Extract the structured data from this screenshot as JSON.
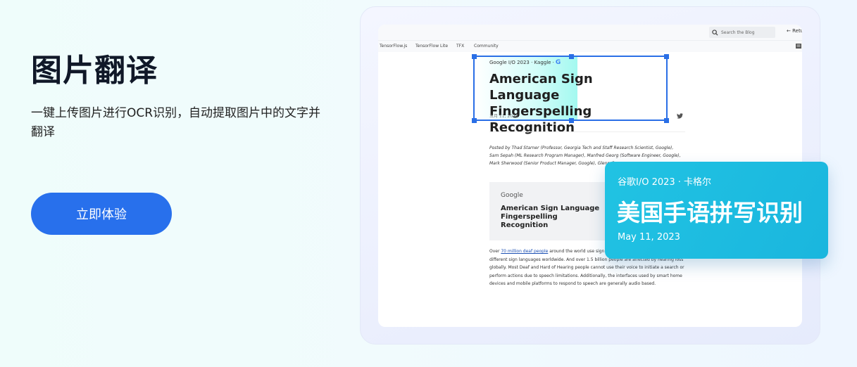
{
  "hero": {
    "title": "图片翻译",
    "description": "一键上传图片进行OCR识别，自动提取图片中的文字并翻译",
    "cta_label": "立即体验"
  },
  "preview": {
    "search_placeholder": "Search the Blog",
    "return_label": "Retu",
    "nav_items": [
      "TensorFlow.js",
      "TensorFlow Lite",
      "TFX",
      "Community"
    ],
    "article": {
      "meta": "Google I/O 2023 · Kaggle ·",
      "title_line1": "American Sign Language",
      "title_line2": "Fingerspelling Recognition",
      "date": "五月 11, 2023",
      "posted_by": "Posted by Thad Starner (Professor, Georgia Tech and Staff Research Scientist, Google), Sam Sepah (ML Research Program Manager), Manfred Georg (Software Engineer, Google), Mark Sherwood (Senior Product Manager, Google), Glenn Cameron",
      "image_card": {
        "brand": "Google",
        "title_line1": "American Sign Language",
        "title_line2": "Fingerspelling Recognition"
      },
      "body_link": "70 million deaf people",
      "body_after_link": " around the world use sign language; they use more than 300 different sign languages worldwide. And over 1.5 billion people are affected by hearing loss globally. Most Deaf and Hard of Hearing people cannot use their voice to initiate a search or perform actions due to speech limitations. Additionally, the interfaces used by smart home devices and mobile platforms to respond to speech are generally audio based.",
      "body_prefix": "Over "
    }
  },
  "translation": {
    "meta": "谷歌I/O 2023 · 卡格尔",
    "title": "美国手语拼写识别",
    "date": "May 11, 2023"
  },
  "colors": {
    "primary": "#2870ec",
    "popup": "#1ab6de",
    "selection": "#2a6fe6"
  }
}
